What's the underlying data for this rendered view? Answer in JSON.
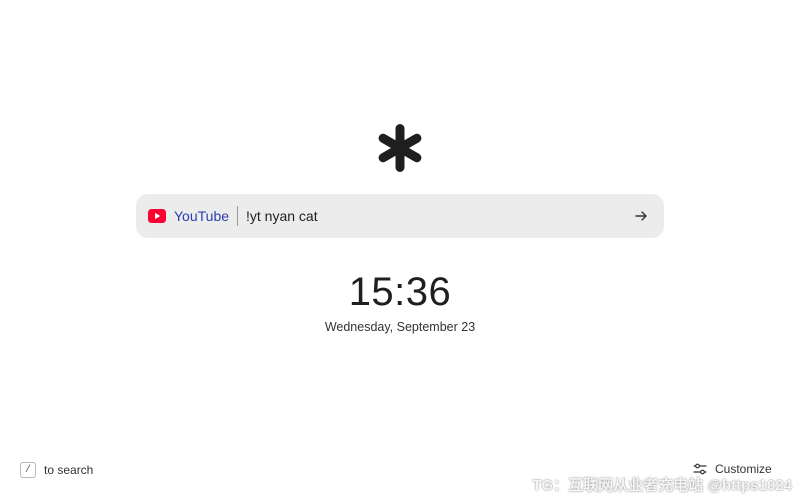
{
  "logo": {
    "icon": "asterisk-logo-icon"
  },
  "search": {
    "engine_icon": "youtube-icon",
    "engine_label": "YouTube",
    "query": "!yt nyan cat",
    "submit_icon": "arrow-right-icon"
  },
  "clock": {
    "time": "15:36",
    "date": "Wednesday, September 23"
  },
  "footer": {
    "shortcut_key": "/",
    "shortcut_label": "to search",
    "customize_icon": "sliders-icon",
    "customize_label": "Customize"
  },
  "watermark": "TG：互联网从业者充电站 @https1024",
  "colors": {
    "search_bg": "#ececec",
    "engine_label": "#2a3fb0",
    "youtube_red": "#ff0033"
  }
}
